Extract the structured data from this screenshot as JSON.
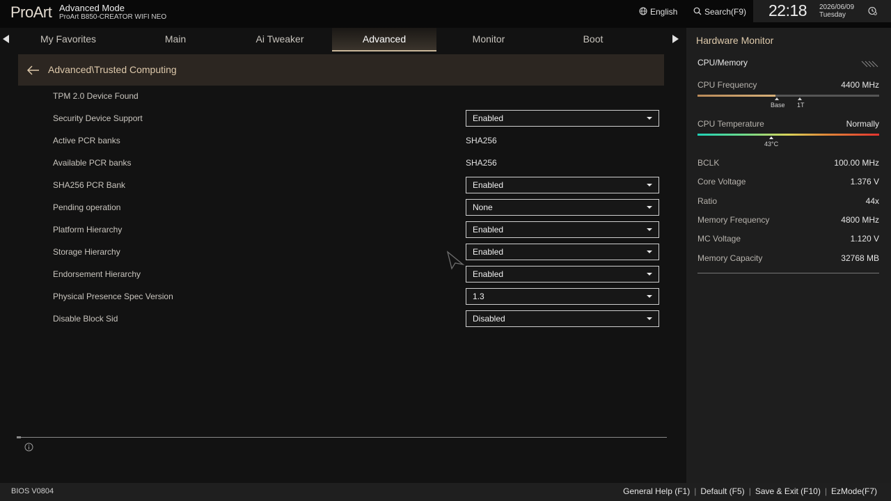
{
  "header": {
    "logo": "ProArt",
    "mode": "Advanced Mode",
    "board": "ProArt B850-CREATOR WIFI NEO",
    "language": "English",
    "search": "Search(F9)",
    "time": "22:18",
    "date": "2026/06/09",
    "weekday": "Tuesday"
  },
  "tabs": [
    {
      "label": "My Favorites"
    },
    {
      "label": "Main"
    },
    {
      "label": "Ai Tweaker"
    },
    {
      "label": "Advanced"
    },
    {
      "label": "Monitor"
    },
    {
      "label": "Boot"
    }
  ],
  "active_tab": "Advanced",
  "breadcrumb": "Advanced\\Trusted Computing",
  "settings": [
    {
      "label": "TPM 2.0 Device Found"
    },
    {
      "label": "Security Device Support",
      "value": "Enabled"
    },
    {
      "label": "Active PCR banks",
      "value": "SHA256"
    },
    {
      "label": "Available PCR banks",
      "value": "SHA256"
    },
    {
      "label": "SHA256 PCR Bank",
      "value": "Enabled"
    },
    {
      "label": "Pending operation",
      "value": "None"
    },
    {
      "label": "Platform Hierarchy",
      "value": "Enabled"
    },
    {
      "label": "Storage Hierarchy",
      "value": "Enabled"
    },
    {
      "label": "Endorsement Hierarchy",
      "value": "Enabled"
    },
    {
      "label": "Physical Presence Spec Version",
      "value": "1.3"
    },
    {
      "label": "Disable Block Sid",
      "value": "Disabled"
    }
  ],
  "hardware_monitor": {
    "title": "Hardware Monitor",
    "section": "CPU/Memory",
    "cpu_frequency": {
      "label": "CPU Frequency",
      "value": "4400 MHz",
      "fill_percent": 43,
      "markers": [
        "Base",
        "1T"
      ]
    },
    "cpu_temperature": {
      "label": "CPU Temperature",
      "value": "Normally",
      "marker_label": "43°C",
      "marker_percent": 41
    },
    "stats": [
      {
        "label": "BCLK",
        "value": "100.00 MHz"
      },
      {
        "label": "Core Voltage",
        "value": "1.376 V"
      },
      {
        "label": "Ratio",
        "value": "44x"
      },
      {
        "label": "Memory Frequency",
        "value": "4800 MHz"
      },
      {
        "label": "MC Voltage",
        "value": "1.120 V"
      },
      {
        "label": "Memory Capacity",
        "value": "32768 MB"
      }
    ]
  },
  "footer": {
    "bios_version": "BIOS V0804",
    "links": [
      "General Help (F1)",
      "Default (F5)",
      "Save & Exit (F10)",
      "EzMode(F7)"
    ]
  },
  "colors": {
    "accent": "#dec9ab",
    "breadcrumb_bg": "#2c2621",
    "panel_bg": "#1e1e1e"
  }
}
